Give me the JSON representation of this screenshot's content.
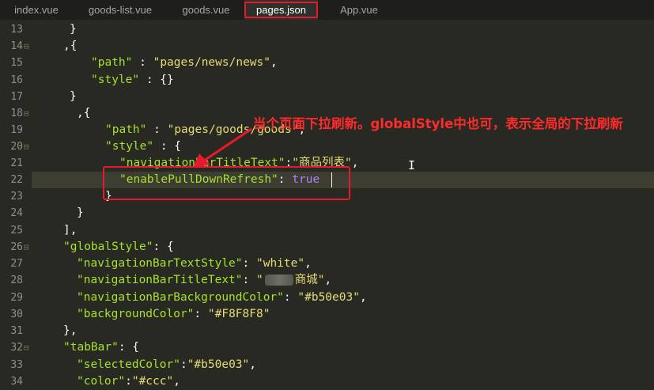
{
  "tabs": [
    {
      "label": "index.vue",
      "active": false
    },
    {
      "label": "goods-list.vue",
      "active": false
    },
    {
      "label": "goods.vue",
      "active": false
    },
    {
      "label": "pages.json",
      "active": true
    },
    {
      "label": "App.vue",
      "active": false
    }
  ],
  "line_numbers": [
    "13",
    "14",
    "15",
    "16",
    "17",
    "18",
    "19",
    "20",
    "21",
    "22",
    "23",
    "24",
    "25",
    "26",
    "27",
    "28",
    "29",
    "30",
    "31",
    "32",
    "33",
    "34"
  ],
  "code": {
    "l13": "}",
    "l14": ",{",
    "l15_key": "\"path\"",
    "l15_val": "\"pages/news/news\"",
    "l16_key": "\"style\"",
    "l16_rest": " : {}",
    "l17": "}",
    "l18": ",{",
    "l19_key": "\"path\"",
    "l19_val": "\"pages/goods/goods\"",
    "l20_key": "\"style\"",
    "l20_rest": " : {",
    "l21_key": "\"navigationBarTitleText\"",
    "l21_val": "\"商品列表\"",
    "l22_key": "\"enablePullDownRefresh\"",
    "l22_val": "true",
    "l23": "}",
    "l24": "}",
    "l25": "],",
    "l26_key": "\"globalStyle\"",
    "l27_key": "\"navigationBarTextStyle\"",
    "l27_val": "\"white\"",
    "l28_key": "\"navigationBarTitleText\"",
    "l28_val_open": "\"",
    "l28_val_rest": "商城\"",
    "l29_key": "\"navigationBarBackgroundColor\"",
    "l29_val": "\"#b50e03\"",
    "l30_key": "\"backgroundColor\"",
    "l30_val": "\"#F8F8F8\"",
    "l31": "},",
    "l32_key": "\"tabBar\"",
    "l33_key": "\"selectedColor\"",
    "l33_val": "\"#b50e03\"",
    "l34_key": "\"color\"",
    "l34_val": "\"#ccc\""
  },
  "annotation": {
    "text": "当个页面下拉刷新。globalStyle中也可，表示全局的下拉刷新"
  },
  "colors": {
    "background": "#282923",
    "key": "#a6e22e",
    "string": "#e6db74",
    "boolean": "#ae81ff",
    "highlight": "#e8192c"
  }
}
